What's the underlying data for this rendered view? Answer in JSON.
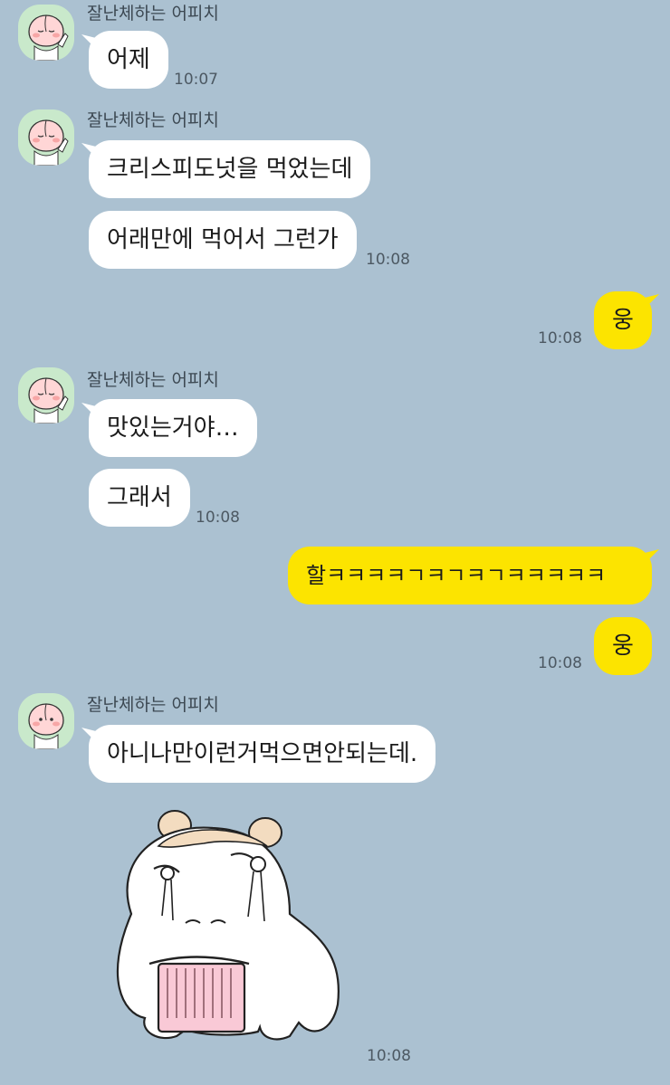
{
  "sender_name": "잘난체하는 어피치",
  "messages": [
    {
      "text": "어제",
      "time": "10:07"
    },
    {
      "text": "크리스피도넛을 먹었는데"
    },
    {
      "text": "어래만에 먹어서 그런가",
      "time": "10:08"
    },
    {
      "text": "웅",
      "time": "10:08"
    },
    {
      "text": "맛있는거야…"
    },
    {
      "text": "그래서",
      "time": "10:08"
    },
    {
      "text": "할ㅋㅋㅋㅋㄱㅋㄱㅋㄱㅋㅋㅋㅋㅋ"
    },
    {
      "text": "웅",
      "time": "10:08"
    },
    {
      "text": "아니나만이런거먹으면안되는데."
    },
    {
      "sticker": "crying-hamster-sticker",
      "time": "10:08"
    }
  ],
  "colors": {
    "background": "#abc1d1",
    "incoming_bubble": "#ffffff",
    "outgoing_bubble": "#fce400",
    "avatar_bg": "#c9e9cb"
  }
}
